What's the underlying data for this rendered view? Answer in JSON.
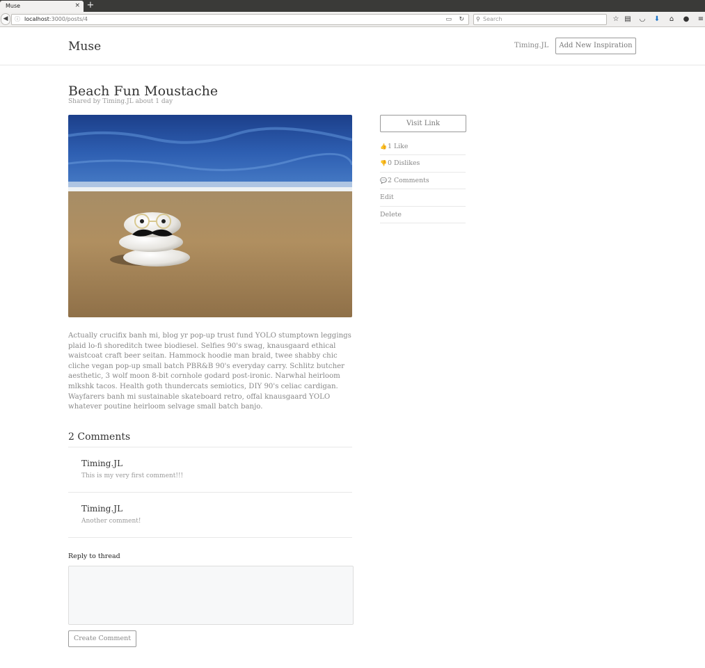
{
  "browser": {
    "tab_title": "Muse",
    "tab_close": "×",
    "new_tab": "+",
    "url_host": "localhost",
    "url_path": ":3000/posts/4",
    "search_placeholder": "Search",
    "icons": [
      "back-icon",
      "info-icon",
      "reader-view-icon",
      "reload-icon",
      "search-icon",
      "bookmark-star-icon",
      "reading-list-icon",
      "pocket-icon",
      "download-icon",
      "home-icon",
      "chat-icon",
      "menu-icon"
    ]
  },
  "header": {
    "brand": "Muse",
    "user": "Timing.JL",
    "add_button": "Add New Inspiration"
  },
  "post": {
    "title": "Beach Fun Moustache",
    "meta": "Shared by Timing.JL about 1 day",
    "image_alt": "beach-stones-moustache-image",
    "body": "Actually crucifix banh mi, blog yr pop-up trust fund YOLO stumptown leggings plaid lo-fi shoreditch twee biodiesel. Selfies 90's swag, knausgaard ethical waistcoat craft beer seitan. Hammock hoodie man braid, twee shabby chic cliche vegan pop-up small batch PBR&B 90's everyday carry. Schlitz butcher aesthetic, 3 wolf moon 8-bit cornhole godard post-ironic. Narwhal heirloom mlkshk tacos. Health goth thundercats semiotics, DIY 90's celiac cardigan. Wayfarers banh mi sustainable skateboard retro, offal knausgaard YOLO whatever poutine heirloom selvage small batch banjo."
  },
  "sidebar": {
    "visit_link": "Visit Link",
    "likes": "1 Like",
    "dislikes": "0 Dislikes",
    "comments": "2 Comments",
    "edit": "Edit",
    "delete": "Delete"
  },
  "comments": {
    "heading": "2 Comments",
    "items": [
      {
        "author": "Timing.JL",
        "text": "This is my very first comment!!!"
      },
      {
        "author": "Timing.JL",
        "text": "Another comment!"
      }
    ]
  },
  "reply": {
    "label": "Reply to thread",
    "value": "",
    "submit": "Create Comment"
  }
}
